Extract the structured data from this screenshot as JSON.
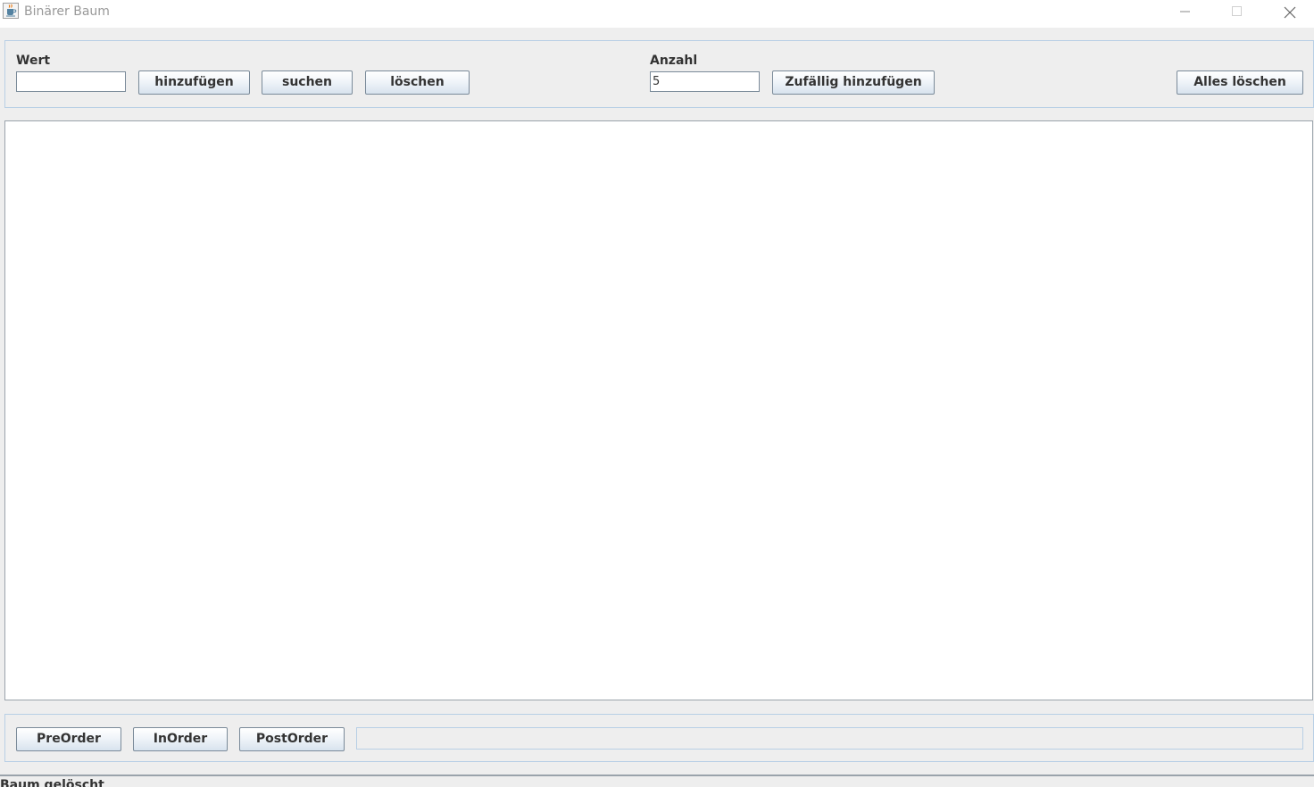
{
  "window": {
    "title": "Binärer Baum",
    "icon": "java-cup-icon"
  },
  "top_panel": {
    "value_label": "Wert",
    "value_input": "",
    "add_button": "hinzufügen",
    "search_button": "suchen",
    "delete_button": "löschen",
    "count_label": "Anzahl",
    "count_input": "5",
    "random_add_button": "Zufällig hinzufügen",
    "clear_all_button": "Alles löschen"
  },
  "bottom_panel": {
    "preorder_button": "PreOrder",
    "inorder_button": "InOrder",
    "postorder_button": "PostOrder",
    "traversal_output": ""
  },
  "status": {
    "text": "Baum gelöscht"
  },
  "colors": {
    "panel_border": "#b8cfe5",
    "background": "#eeeeee",
    "canvas": "#ffffff"
  }
}
